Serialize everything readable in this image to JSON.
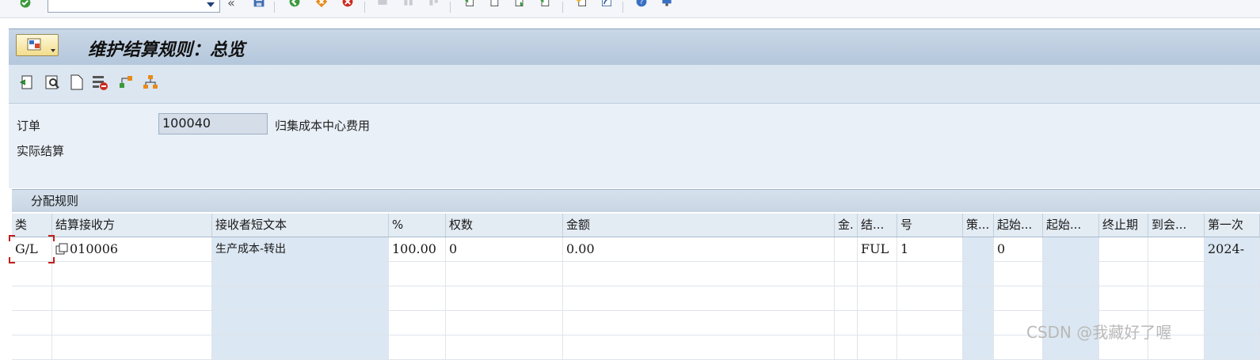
{
  "window": {
    "title": "维护结算规则：总览"
  },
  "system_toolbar": {
    "command_field": {
      "value": "",
      "placeholder": ""
    },
    "icons": [
      "enter-icon",
      "back-double-icon",
      "save-icon",
      "back-icon",
      "exit-icon",
      "cancel-icon",
      "print-icon",
      "find-icon",
      "find-next-icon",
      "first-page-icon",
      "prev-page-icon",
      "next-page-icon",
      "last-page-icon",
      "new-session-icon",
      "shortcut-icon",
      "help-icon",
      "layout-icon"
    ]
  },
  "app_toolbar": {
    "icons": [
      "previous-level-icon",
      "detail-icon",
      "new-entry-icon",
      "delete-row-icon",
      "hierarchy-up-icon",
      "hierarchy-icon"
    ]
  },
  "header": {
    "order_label": "订单",
    "order_value": "100040",
    "order_description": "归集成本中心费用",
    "settlement_label": "实际结算"
  },
  "table": {
    "title": "分配规则",
    "columns": [
      "类",
      "结算接收方",
      "接收者短文本",
      "%",
      "权数",
      "金额",
      "金.",
      "结...",
      "号",
      "策...",
      "起始...",
      "起始...",
      "终止期",
      "到会...",
      "第一次"
    ],
    "rows": [
      {
        "type": "G/L",
        "receiver": "010006",
        "short_text": "生产成本-转出",
        "percent": "100.00",
        "weight": "0",
        "amount": "0.00",
        "currency": "",
        "settlement_type": "FUL",
        "number": "1",
        "strategy": "",
        "from_period": "0",
        "from_year": "",
        "to_period": "",
        "to_year": "",
        "first_used": "2024-"
      }
    ]
  },
  "watermark": "CSDN @我藏好了喔",
  "colors": {
    "title_bar": "#b4c7dc",
    "toolbar": "#dbe6f1",
    "header_bg": "#e9f0f7",
    "focus_marker": "#c0201a",
    "shaded_column": "#dbe7f2"
  }
}
